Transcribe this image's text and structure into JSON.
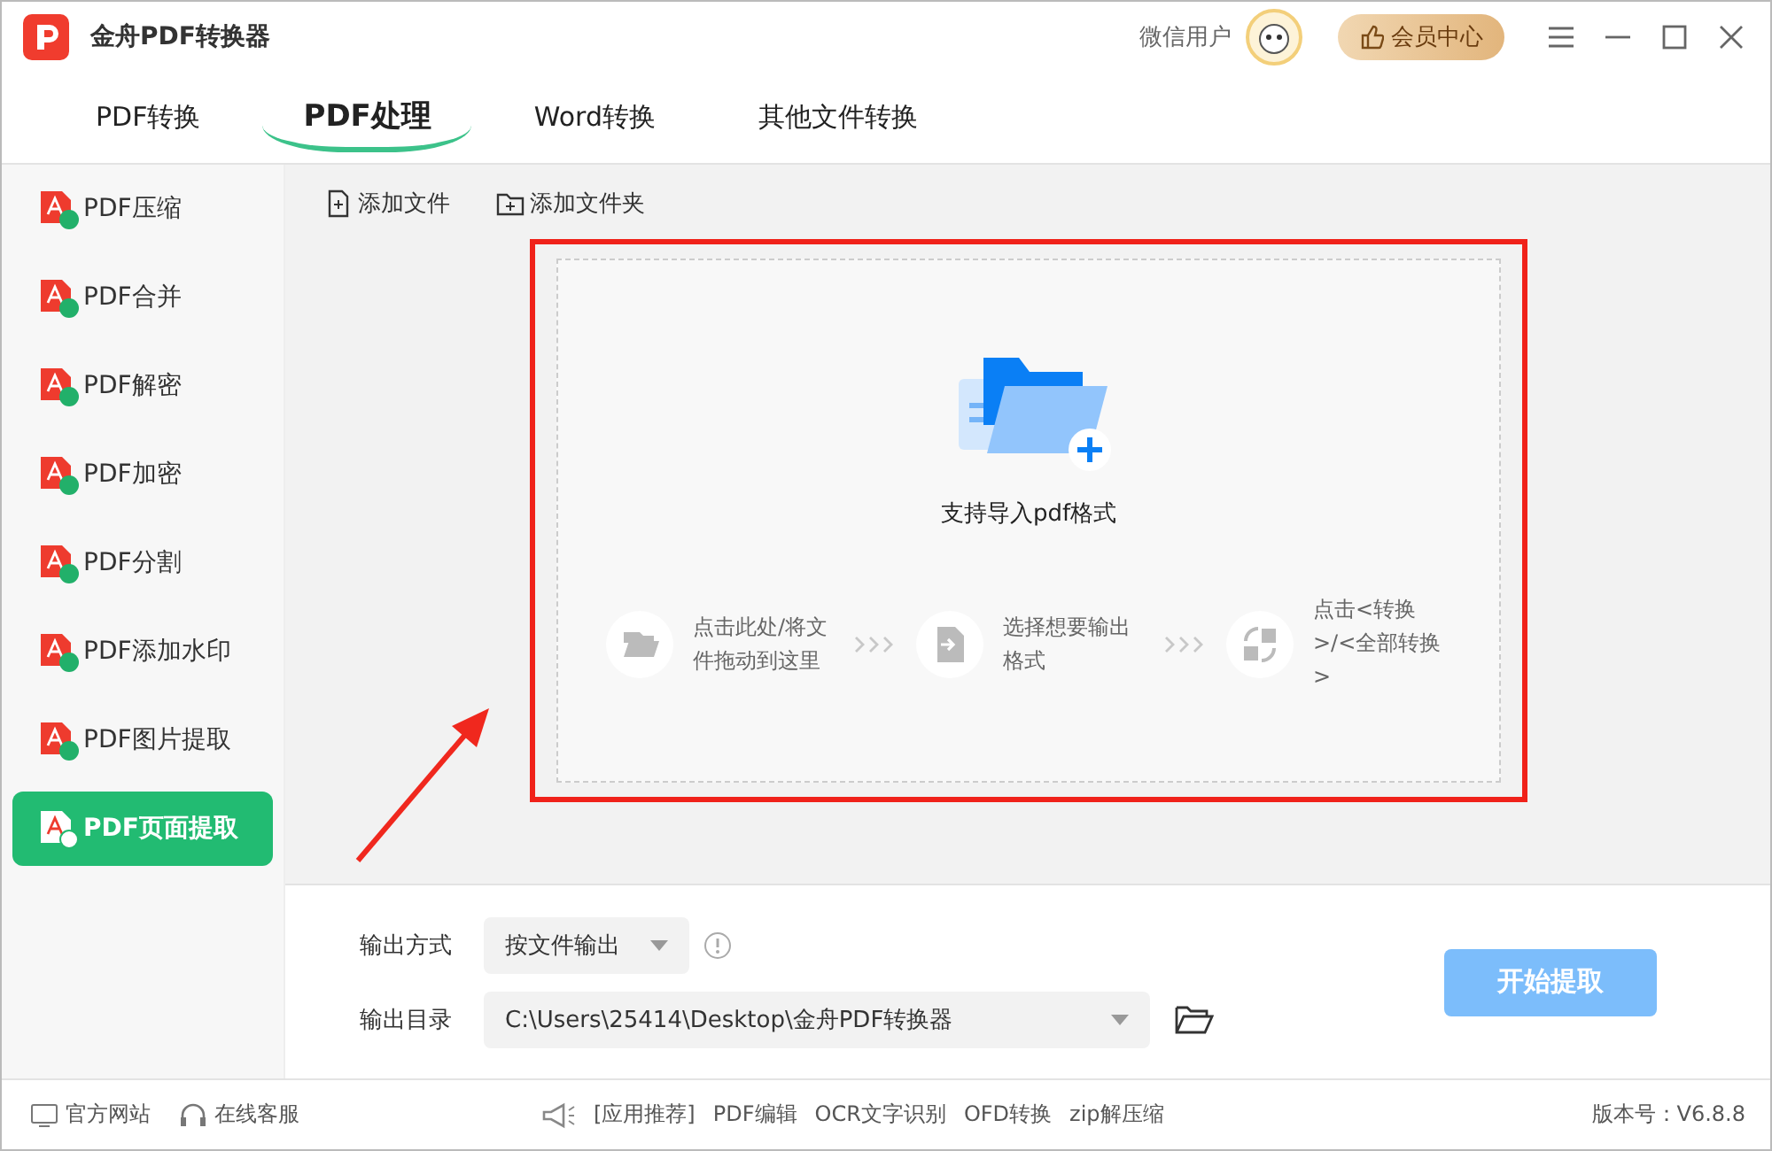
{
  "window": {
    "title": "金舟PDF转换器",
    "user": "微信用户",
    "vip_button": "会员中心"
  },
  "tabs": [
    {
      "label": "PDF转换",
      "selected": false
    },
    {
      "label": "PDF处理",
      "selected": true
    },
    {
      "label": "Word转换",
      "selected": false
    },
    {
      "label": "其他文件转换",
      "selected": false
    }
  ],
  "sidebar": {
    "items": [
      {
        "label": "PDF压缩",
        "selected": false
      },
      {
        "label": "PDF合并",
        "selected": false
      },
      {
        "label": "PDF解密",
        "selected": false
      },
      {
        "label": "PDF加密",
        "selected": false
      },
      {
        "label": "PDF分割",
        "selected": false
      },
      {
        "label": "PDF添加水印",
        "selected": false
      },
      {
        "label": "PDF图片提取",
        "selected": false
      },
      {
        "label": "PDF页面提取",
        "selected": true
      }
    ]
  },
  "toolbar": [
    {
      "kind": "file",
      "label": "添加文件"
    },
    {
      "kind": "folder",
      "label": "添加文件夹"
    }
  ],
  "drop_zone": {
    "hint": "支持导入pdf格式",
    "highlighted": true,
    "steps": [
      {
        "kind": "open",
        "text": "点击此处/将文件拖动到这里"
      },
      {
        "kind": "output",
        "text": "选择想要输出格式"
      },
      {
        "kind": "convert",
        "text": "点击<转换>/<全部转换>"
      }
    ]
  },
  "output": {
    "mode_label": "输出方式",
    "mode_value": "按文件输出",
    "dir_label": "输出目录",
    "dir_value": "C:\\Users\\25414\\Desktop\\金舟PDF转换器",
    "start_button": "开始提取"
  },
  "status_bar": {
    "left": [
      "官方网站",
      "在线客服"
    ],
    "recommend": "[应用推荐]",
    "links": [
      "PDF编辑",
      "OCR文字识别",
      "OFD转换",
      "zip解压缩"
    ],
    "version": "版本号：V6.8.8"
  }
}
